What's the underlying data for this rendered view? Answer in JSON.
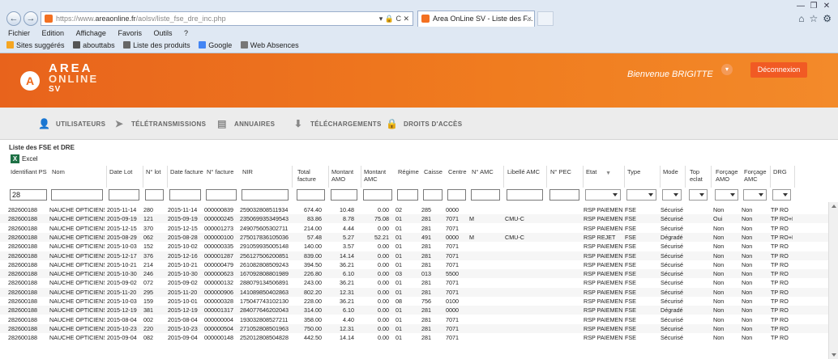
{
  "browser": {
    "url_prefix": "https://www.",
    "url_domain": "areaonline.fr",
    "url_path": "/aolsv/liste_fse_dre_inc.php",
    "url_controls": "▾ 🔒 C ✕",
    "tab_title": "Area OnLine SV - Liste des F...",
    "tab_close": "×",
    "menu": [
      "Fichier",
      "Edition",
      "Affichage",
      "Favoris",
      "Outils",
      "?"
    ],
    "favorites": [
      {
        "label": "Sites suggérés",
        "color": "#f5a623"
      },
      {
        "label": "abouttabs",
        "color": "#555555"
      },
      {
        "label": "Liste des produits",
        "color": "#666666"
      },
      {
        "label": "Google",
        "color": "#4285f4"
      },
      {
        "label": "Web Absences",
        "color": "#777777"
      }
    ],
    "window_buttons": [
      "—",
      "❐",
      "✕"
    ],
    "tools": [
      "⌂",
      "☆",
      "⚙"
    ],
    "back": "←",
    "forward": "→"
  },
  "header": {
    "logo_mark": "A",
    "logo_line1": "AREA",
    "logo_line2": "ONLINE",
    "logo_line3": "SV",
    "welcome": "Bienvenue BRIGITTE",
    "chevron": "▾",
    "logout_label": "Déconnexion",
    "accent_color": "#ef6b1e"
  },
  "nav": {
    "items": [
      {
        "label": "UTILISATEURS",
        "icon": "user-icon",
        "glyph": "👤"
      },
      {
        "label": "TÉLÉTRANSMISSIONS",
        "icon": "send-icon",
        "glyph": "➤"
      },
      {
        "label": "ANNUAIRES",
        "icon": "book-icon",
        "glyph": "▤"
      },
      {
        "label": "TÉLÉCHARGEMENTS",
        "icon": "download-icon",
        "glyph": "⬇"
      },
      {
        "label": "DROITS D'ACCÈS",
        "icon": "lock-icon",
        "glyph": "🔒"
      }
    ]
  },
  "page": {
    "section_title": "Liste des FSE et DRE",
    "excel_label": "Excel",
    "excel_glyph": "X"
  },
  "table": {
    "headers": [
      "Identifiant PS",
      "Nom",
      "Date Lot",
      "N° lot",
      "Date facture",
      "N° facture",
      "NIR",
      "Total facture",
      "Montant AMO",
      "Montant AMC",
      "Régime",
      "Caisse",
      "Centre",
      "N° AMC",
      "Libellé AMC",
      "N° PEC",
      "Etat",
      "Type",
      "Mode",
      "Top eclat",
      "Forçage AMO",
      "Forçage AMC",
      "DRG"
    ],
    "filter_id_value": "28",
    "rows": [
      [
        "282600188",
        "NAUCHE OPTICIENS A",
        "2015-11-14",
        "280",
        "2015-11-14",
        "000000839",
        "259032808511934",
        "674.40",
        "10.48",
        "0.00",
        "02",
        "285",
        "0000",
        "",
        "",
        "",
        "RSP PAIEMENT",
        "FSE",
        "Sécurisé",
        "",
        "Non",
        "Non",
        "TP RO"
      ],
      [
        "282600188",
        "NAUCHE OPTICIENS A",
        "2015-09-19",
        "121",
        "2015-09-19",
        "000000245",
        "235069935349543",
        "83.86",
        "8.78",
        "75.08",
        "01",
        "281",
        "7071",
        "M",
        "CMU-C",
        "",
        "RSP PAIEMENT",
        "FSE",
        "Sécurisé",
        "",
        "Oui",
        "Non",
        "TP RO+RC"
      ],
      [
        "282600188",
        "NAUCHE OPTICIENS A",
        "2015-12-15",
        "370",
        "2015-12-15",
        "000001273",
        "249075605302711",
        "214.00",
        "4.44",
        "0.00",
        "01",
        "281",
        "7071",
        "",
        "",
        "",
        "RSP PAIEMENT",
        "FSE",
        "Sécurisé",
        "",
        "Non",
        "Non",
        "TP RO"
      ],
      [
        "282600188",
        "NAUCHE OPTICIENS A",
        "2015-08-29",
        "062",
        "2015-08-28",
        "000000100",
        "275017836105036",
        "57.48",
        "5.27",
        "52.21",
        "01",
        "491",
        "0000",
        "M",
        "CMU-C",
        "",
        "RSP REJET",
        "FSE",
        "Dégradé",
        "",
        "Non",
        "Non",
        "TP RO+RC"
      ],
      [
        "282600188",
        "NAUCHE OPTICIENS A",
        "2015-10-03",
        "152",
        "2015-10-02",
        "000000335",
        "291059935005148",
        "140.00",
        "3.57",
        "0.00",
        "01",
        "281",
        "7071",
        "",
        "",
        "",
        "RSP PAIEMENT",
        "FSE",
        "Sécurisé",
        "",
        "Non",
        "Non",
        "TP RO"
      ],
      [
        "282600188",
        "NAUCHE OPTICIENS A",
        "2015-12-17",
        "376",
        "2015-12-16",
        "000001287",
        "256127506200851",
        "839.00",
        "14.14",
        "0.00",
        "01",
        "281",
        "7071",
        "",
        "",
        "",
        "RSP PAIEMENT",
        "FSE",
        "Sécurisé",
        "",
        "Non",
        "Non",
        "TP RO"
      ],
      [
        "282600188",
        "NAUCHE OPTICIENS A",
        "2015-10-21",
        "214",
        "2015-10-21",
        "000000479",
        "261082808509243",
        "394.50",
        "36.21",
        "0.00",
        "01",
        "281",
        "7071",
        "",
        "",
        "",
        "RSP PAIEMENT",
        "FSE",
        "Sécurisé",
        "",
        "Non",
        "Non",
        "TP RO"
      ],
      [
        "282600188",
        "NAUCHE OPTICIENS A",
        "2015-10-30",
        "246",
        "2015-10-30",
        "000000623",
        "167092808801989",
        "226.80",
        "6.10",
        "0.00",
        "03",
        "013",
        "5500",
        "",
        "",
        "",
        "RSP PAIEMENT",
        "FSE",
        "Sécurisé",
        "",
        "Non",
        "Non",
        "TP RO"
      ],
      [
        "282600188",
        "NAUCHE OPTICIENS A",
        "2015-09-02",
        "072",
        "2015-09-02",
        "000000132",
        "288079134506891",
        "243.00",
        "36.21",
        "0.00",
        "01",
        "281",
        "7071",
        "",
        "",
        "",
        "RSP PAIEMENT",
        "FSE",
        "Sécurisé",
        "",
        "Non",
        "Non",
        "TP RO"
      ],
      [
        "282600188",
        "NAUCHE OPTICIENS A",
        "2015-11-20",
        "295",
        "2015-11-20",
        "000000906",
        "141089850402863",
        "802.20",
        "12.31",
        "0.00",
        "01",
        "281",
        "7071",
        "",
        "",
        "",
        "RSP PAIEMENT",
        "FSE",
        "Sécurisé",
        "",
        "Non",
        "Non",
        "TP RO"
      ],
      [
        "282600188",
        "NAUCHE OPTICIENS A",
        "2015-10-03",
        "159",
        "2015-10-01",
        "000000328",
        "175047743102130",
        "228.00",
        "36.21",
        "0.00",
        "08",
        "756",
        "0100",
        "",
        "",
        "",
        "RSP PAIEMENT",
        "FSE",
        "Sécurisé",
        "",
        "Non",
        "Non",
        "TP RO"
      ],
      [
        "282600188",
        "NAUCHE OPTICIENS A",
        "2015-12-19",
        "381",
        "2015-12-19",
        "000001317",
        "284077646202043",
        "314.00",
        "6.10",
        "0.00",
        "01",
        "281",
        "0000",
        "",
        "",
        "",
        "RSP PAIEMENT",
        "FSE",
        "Dégradé",
        "",
        "Non",
        "Non",
        "TP RO"
      ],
      [
        "282600188",
        "NAUCHE OPTICIENS A",
        "2015-08-04",
        "002",
        "2015-08-04",
        "000000004",
        "193032808527211",
        "358.00",
        "4.40",
        "0.00",
        "01",
        "281",
        "7071",
        "",
        "",
        "",
        "RSP PAIEMENT",
        "FSE",
        "Sécurisé",
        "",
        "Non",
        "Non",
        "TP RO"
      ],
      [
        "282600188",
        "NAUCHE OPTICIENS A",
        "2015-10-23",
        "220",
        "2015-10-23",
        "000000504",
        "271052808501963",
        "750.00",
        "12.31",
        "0.00",
        "01",
        "281",
        "7071",
        "",
        "",
        "",
        "RSP PAIEMENT",
        "FSE",
        "Sécurisé",
        "",
        "Non",
        "Non",
        "TP RO"
      ],
      [
        "282600188",
        "NAUCHE OPTICIENS A",
        "2015-09-04",
        "082",
        "2015-09-04",
        "000000148",
        "252012808504828",
        "442.50",
        "14.14",
        "0.00",
        "01",
        "281",
        "7071",
        "",
        "",
        "",
        "RSP PAIEMENT",
        "FSE",
        "Sécurisé",
        "",
        "Non",
        "Non",
        "TP RO"
      ]
    ]
  }
}
